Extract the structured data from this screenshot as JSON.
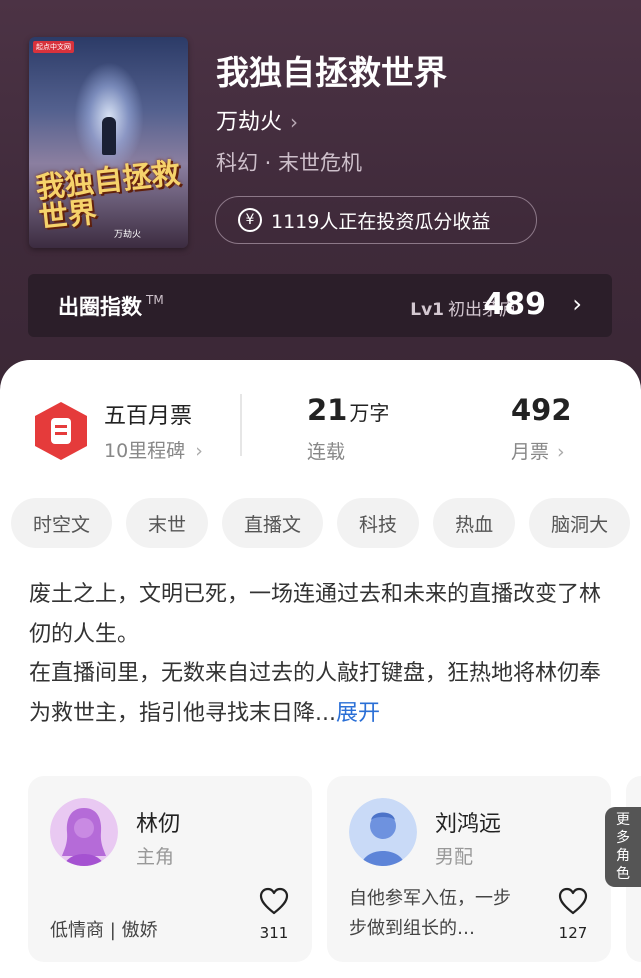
{
  "book": {
    "title": "我独自拯救世界",
    "author": "万劫火",
    "genre": "科幻 · 末世危机",
    "cover_publisher": "起点中文网",
    "cover_title": "我独自拯救世界",
    "cover_author": "万劫火",
    "invest_text": "1119人正在投资瓜分收益",
    "invest_icon": "yen-coin-icon"
  },
  "index": {
    "label": "出圈指数",
    "tm": "TM",
    "level": "Lv1",
    "level_name": "初出茅庐",
    "score": "489"
  },
  "stats": {
    "milestone_title": "五百月票",
    "milestone_sub": "10里程碑",
    "words_value": "21",
    "words_unit": "万字",
    "words_label": "连载",
    "tickets_value": "492",
    "tickets_label": "月票"
  },
  "tags": [
    "时空文",
    "末世",
    "直播文",
    "科技",
    "热血",
    "脑洞大"
  ],
  "intro": {
    "line1": "废土之上，文明已死，一场连通过去和未来的直播改变了林仞的人生。",
    "line2": "在直播间里，无数来自过去的人敲打键盘，狂热地将林仞奉为救世主，指引他寻找末日降...",
    "expand": "展开"
  },
  "characters": [
    {
      "name": "林仞",
      "role": "主角",
      "desc": "低情商 | 傲娇",
      "likes": "311"
    },
    {
      "name": "刘鸿远",
      "role": "男配",
      "desc": "自他参军入伍，一步步做到组长的…",
      "likes": "127"
    }
  ],
  "more_roles": "更多角色",
  "colors": {
    "hero_bg": "#4c3345",
    "accent_link": "#2a6fd6",
    "badge_red": "#e53b3b"
  }
}
